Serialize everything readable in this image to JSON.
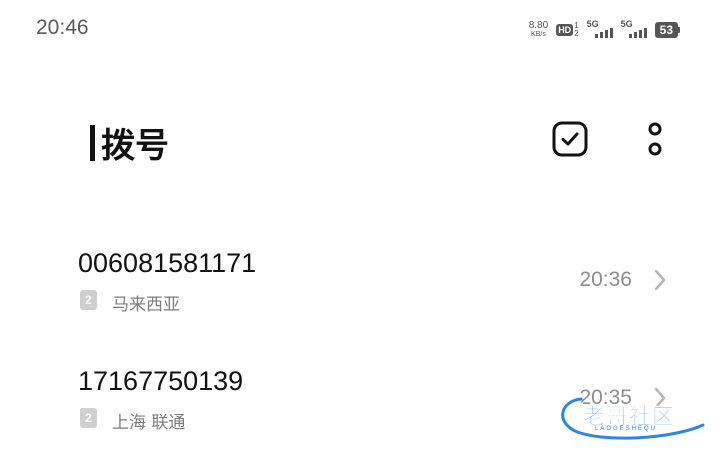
{
  "status_bar": {
    "time": "20:46",
    "net_speed_value": "8.80",
    "net_speed_unit": "KB/s",
    "hd_label": "HD",
    "hd_sim_top": "1",
    "hd_sim_bottom": "2",
    "signal1_label": "5G",
    "signal2_label": "5G",
    "battery_level": "53"
  },
  "header": {
    "title": "拨号",
    "select_icon": "checkbox-select-icon",
    "more_icon": "more-vertical-icon"
  },
  "call_log": [
    {
      "number": "006081581171",
      "sim": "2",
      "location": "马来西亚",
      "time": "20:36"
    },
    {
      "number": "17167750139",
      "sim": "2",
      "location": "上海 联通",
      "time": "20:35"
    }
  ],
  "watermark": {
    "text": "老哥社区",
    "subtext": "LAOGESHEQU"
  },
  "colors": {
    "accent_watermark": "#2d86e6",
    "secondary_text": "#8c8c8c",
    "primary_text": "#111111"
  }
}
